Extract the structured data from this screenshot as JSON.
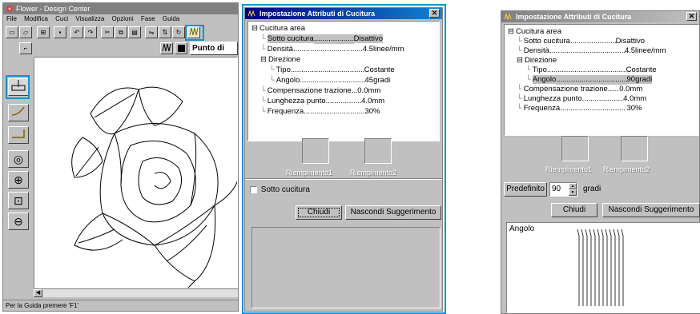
{
  "main": {
    "title": "Flower - Design Center",
    "menu": [
      "File",
      "Modifica",
      "Cuci",
      "Visualizza",
      "Opzioni",
      "Fase",
      "Guida"
    ],
    "stitch_label": "Punto di",
    "status": "Per la Guida premere 'F1'"
  },
  "dialog": {
    "title": "Impostazione Attributi di Cucitura",
    "close": "✕",
    "tree": [
      {
        "label": "Cucitura area",
        "value": "",
        "level": 0,
        "expander": "⊟"
      },
      {
        "label": "Sotto cucitura",
        "value": "Disattivo",
        "level": 1
      },
      {
        "label": "Densità",
        "value": "4.5linee/mm",
        "level": 1
      },
      {
        "label": "Direzione",
        "value": "",
        "level": 1,
        "expander": "⊟"
      },
      {
        "label": "Tipo",
        "value": "Costante",
        "level": 2
      },
      {
        "label": "Angolo",
        "value": "45gradi",
        "level": 2
      },
      {
        "label": "Compensazione trazione",
        "value": "0.0mm",
        "level": 1
      },
      {
        "label": "Lunghezza punto",
        "value": "4.0mm",
        "level": 1
      },
      {
        "label": "Frequenza",
        "value": "30%",
        "level": 1
      }
    ],
    "fill1": "Riempimento1",
    "fill2": "Riempimento2",
    "checkbox": "Sotto cucitura",
    "btn_close": "Chiudi",
    "btn_hide": "Nascondi Suggerimento"
  },
  "dialog2": {
    "title": "Impostazione Attributi di Cucitura",
    "close": "✕",
    "tree": [
      {
        "label": "Cucitura area",
        "value": "",
        "level": 0,
        "expander": "⊟"
      },
      {
        "label": "Sotto cucitura",
        "value": "Disattivo",
        "level": 1
      },
      {
        "label": "Densità",
        "value": "4.5linee/mm",
        "level": 1
      },
      {
        "label": "Direzione",
        "value": "",
        "level": 1,
        "expander": "⊟"
      },
      {
        "label": "Tipo",
        "value": "Costante",
        "level": 2
      },
      {
        "label": "Angolo",
        "value": "90gradi",
        "level": 2
      },
      {
        "label": "Compensazione trazione",
        "value": "0.0mm",
        "level": 1
      },
      {
        "label": "Lunghezza punto",
        "value": "4.0mm",
        "level": 1
      },
      {
        "label": "Frequenza",
        "value": "30%",
        "level": 1
      }
    ],
    "fill1": "Riempimento1",
    "fill2": "Riempimento2",
    "default_btn": "Predefinito",
    "spin_value": "90",
    "unit": "gradi",
    "btn_close": "Chiudi",
    "btn_hide": "Nascondi Suggerimento",
    "preview_label": "Angolo"
  },
  "colors": {
    "highlight": "#1a8fd0",
    "titlebar_active": "#000080",
    "face": "#c0c0c0"
  }
}
